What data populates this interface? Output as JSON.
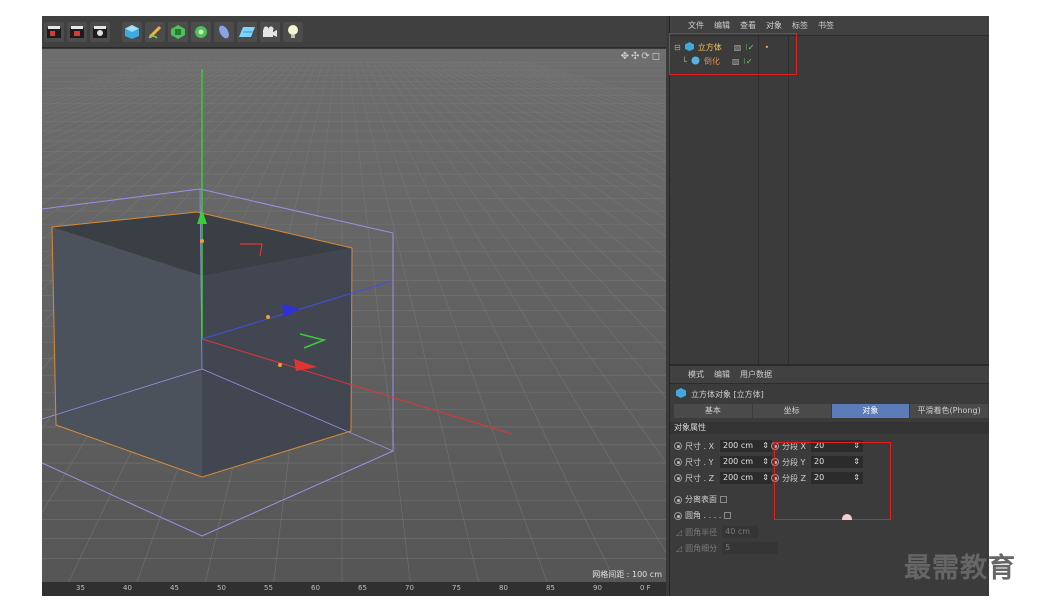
{
  "toolbar": {
    "icons": [
      "render-region-icon",
      "render-view-icon",
      "render-settings-icon",
      "cube-icon",
      "pen-icon",
      "subdivision-icon",
      "cloner-icon",
      "deformer-icon",
      "floor-icon",
      "camera-icon",
      "light-icon"
    ]
  },
  "viewport": {
    "grid_spacing_label": "网格间距 : 100 cm",
    "nav_icons": "✥✣⟳◻",
    "timeline_ticks": [
      "35",
      "40",
      "45",
      "50",
      "55",
      "60",
      "65",
      "70",
      "75",
      "80",
      "85",
      "90",
      "0 F"
    ]
  },
  "object_manager": {
    "menu": [
      "文件",
      "编辑",
      "查看",
      "对象",
      "标签",
      "书签"
    ],
    "objects": [
      {
        "name": "立方体",
        "state": "selected"
      },
      {
        "name": "倒化",
        "state": "child"
      }
    ]
  },
  "attribute_manager": {
    "menu": [
      "模式",
      "编辑",
      "用户数据"
    ],
    "title": "立方体对象 [立方体]",
    "tabs": [
      "基本",
      "坐标",
      "对象",
      "平滑着色(Phong)"
    ],
    "active_tab": "对象",
    "section": "对象属性",
    "size_fields": [
      {
        "label": "尺寸 . X",
        "value": "200 cm"
      },
      {
        "label": "尺寸 . Y",
        "value": "200 cm"
      },
      {
        "label": "尺寸 . Z",
        "value": "200 cm"
      }
    ],
    "segment_fields": [
      {
        "label": "分段 X",
        "value": "20"
      },
      {
        "label": "分段 Y",
        "value": "20"
      },
      {
        "label": "分段 Z",
        "value": "20"
      }
    ],
    "separate_surfaces": "分离表面",
    "fillet": "圆角 . . . .",
    "fillet_radius": {
      "label": "圆角半径",
      "value": "40 cm"
    },
    "fillet_subdivision": {
      "label": "圆角细分",
      "value": "5"
    }
  },
  "watermark": "最需教育"
}
